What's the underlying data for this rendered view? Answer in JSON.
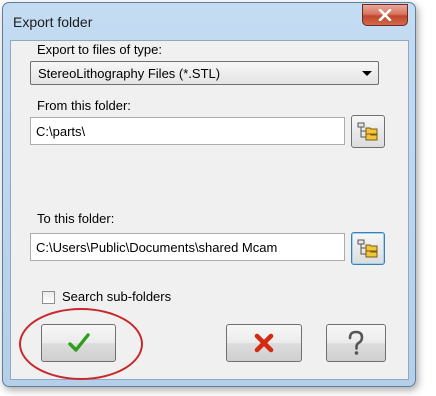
{
  "window": {
    "title": "Export folder"
  },
  "export_type": {
    "label": "Export to files of type:",
    "selected": "StereoLithography Files (*.STL)"
  },
  "from_folder": {
    "label": "From this folder:",
    "value": "C:\\parts\\"
  },
  "to_folder": {
    "label": "To this folder:",
    "value": "C:\\Users\\Public\\Documents\\shared Mcam"
  },
  "search_subfolders": {
    "label": "Search sub-folders",
    "checked": false
  },
  "icons": {
    "close": "close-icon",
    "browse": "folder-browse-icon",
    "ok": "green-checkmark-icon",
    "cancel": "red-x-icon",
    "help": "question-mark-icon"
  },
  "colors": {
    "ok_check": "#2e9e1e",
    "cancel_x": "#d42a10",
    "highlight_ring": "#c8282c",
    "folder_yellow": "#f2c53b"
  }
}
